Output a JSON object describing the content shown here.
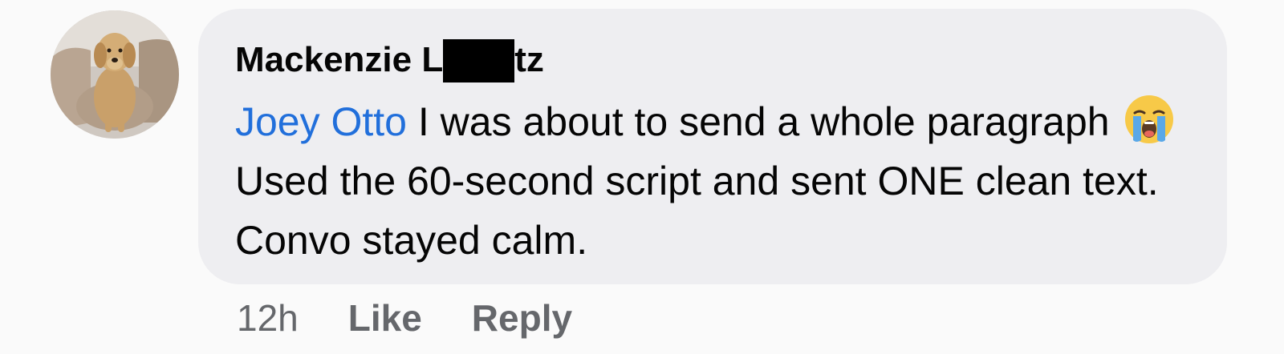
{
  "comment": {
    "author": {
      "name_start": "Mackenzie L",
      "name_end": "tz",
      "avatar_icon": "dog-photo-avatar"
    },
    "mention": "Joey Otto",
    "text_before_emoji": " I was about to send a whole paragraph ",
    "emoji": "loudly-crying-face-icon",
    "text_after_emoji": " Used the 60-second script and sent ONE clean text. Convo stayed calm."
  },
  "actions": {
    "timestamp": "12h",
    "like_label": "Like",
    "reply_label": "Reply"
  },
  "colors": {
    "mention": "#216fdb",
    "bubble": "#eeeef1",
    "muted": "#65676b"
  }
}
